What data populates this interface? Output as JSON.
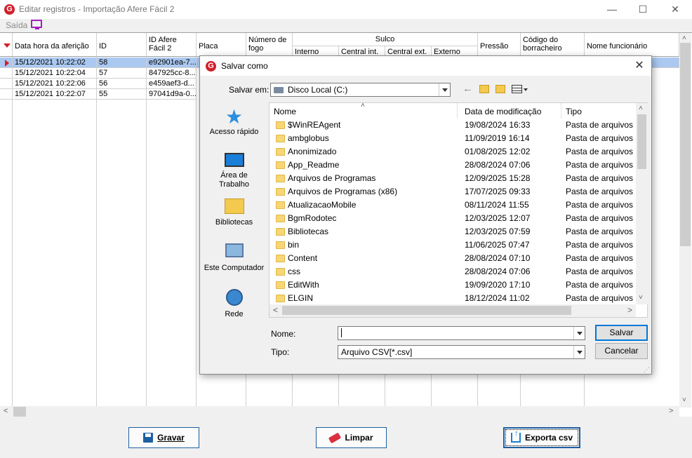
{
  "window": {
    "title": "Editar registros - Importação Afere Fácil 2",
    "menu": {
      "saida": "Saída"
    }
  },
  "grid": {
    "columns": {
      "data_hora": "Data hora da aferição",
      "id": "ID",
      "id_afere": "ID Afere Fácil 2",
      "placa": "Placa",
      "numero_fogo": "Número de fogo",
      "sulco": "Sulco",
      "sulco_interno": "Interno",
      "sulco_central_int": "Central int.",
      "sulco_central_ext": "Central ext.",
      "sulco_externo": "Externo",
      "pressao": "Pressão",
      "codigo_borracheiro": "Código do borracheiro",
      "nome_funcionario": "Nome funcionário"
    },
    "rows": [
      {
        "data_hora": "15/12/2021 10:22:02",
        "id": "58",
        "id_afere": "e92901ea-7..."
      },
      {
        "data_hora": "15/12/2021 10:22:04",
        "id": "57",
        "id_afere": "847925cc-8..."
      },
      {
        "data_hora": "15/12/2021 10:22:06",
        "id": "56",
        "id_afere": "e459aef3-d..."
      },
      {
        "data_hora": "15/12/2021 10:22:07",
        "id": "55",
        "id_afere": "97041d9a-0..."
      }
    ]
  },
  "buttons": {
    "gravar": "Gravar",
    "limpar": "Limpar",
    "exporta": "Exporta csv"
  },
  "dialog": {
    "title": "Salvar como",
    "save_in_label": "Salvar em:",
    "save_in_value": "Disco Local (C:)",
    "places": {
      "quick": "Acesso rápido",
      "desktop": "Área de Trabalho",
      "libraries": "Bibliotecas",
      "computer": "Este Computador",
      "network": "Rede"
    },
    "columns": {
      "name": "Nome",
      "modified": "Data de modificação",
      "type": "Tipo"
    },
    "files": [
      {
        "name": "$WinREAgent",
        "date": "19/08/2024 16:33",
        "type": "Pasta de arquivos"
      },
      {
        "name": "ambglobus",
        "date": "11/09/2019 16:14",
        "type": "Pasta de arquivos"
      },
      {
        "name": "Anonimizado",
        "date": "01/08/2025 12:02",
        "type": "Pasta de arquivos"
      },
      {
        "name": "App_Readme",
        "date": "28/08/2024 07:06",
        "type": "Pasta de arquivos"
      },
      {
        "name": "Arquivos de Programas",
        "date": "12/09/2025 15:28",
        "type": "Pasta de arquivos"
      },
      {
        "name": "Arquivos de Programas (x86)",
        "date": "17/07/2025 09:33",
        "type": "Pasta de arquivos"
      },
      {
        "name": "AtualizacaoMobile",
        "date": "08/11/2024 11:55",
        "type": "Pasta de arquivos"
      },
      {
        "name": "BgmRodotec",
        "date": "12/03/2025 12:07",
        "type": "Pasta de arquivos"
      },
      {
        "name": "Bibliotecas",
        "date": "12/03/2025 07:59",
        "type": "Pasta de arquivos"
      },
      {
        "name": "bin",
        "date": "11/06/2025 07:47",
        "type": "Pasta de arquivos"
      },
      {
        "name": "Content",
        "date": "28/08/2024 07:10",
        "type": "Pasta de arquivos"
      },
      {
        "name": "css",
        "date": "28/08/2024 07:06",
        "type": "Pasta de arquivos"
      },
      {
        "name": "EditWith",
        "date": "19/09/2020 17:10",
        "type": "Pasta de arquivos"
      },
      {
        "name": "ELGIN",
        "date": "18/12/2024 11:02",
        "type": "Pasta de arquivos"
      }
    ],
    "filename_label": "Nome:",
    "filename_value": "",
    "type_label": "Tipo:",
    "type_value": "Arquivo CSV[*.csv]",
    "save_button": "Salvar",
    "cancel_button": "Cancelar"
  }
}
